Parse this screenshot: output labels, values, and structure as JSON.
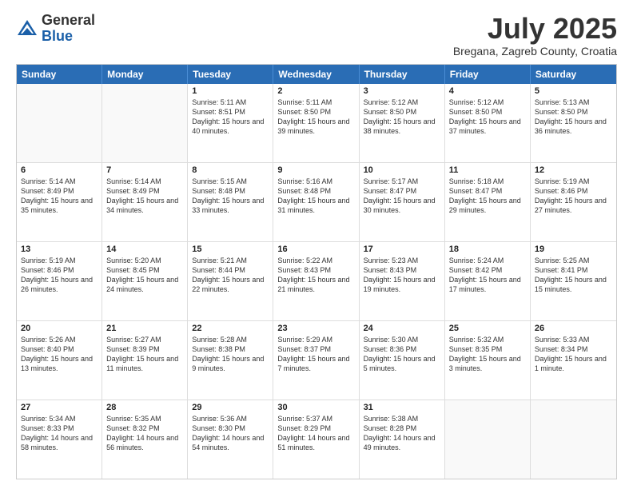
{
  "header": {
    "logo_general": "General",
    "logo_blue": "Blue",
    "month": "July 2025",
    "location": "Bregana, Zagreb County, Croatia"
  },
  "days_of_week": [
    "Sunday",
    "Monday",
    "Tuesday",
    "Wednesday",
    "Thursday",
    "Friday",
    "Saturday"
  ],
  "weeks": [
    [
      {
        "day": "",
        "empty": true
      },
      {
        "day": "",
        "empty": true
      },
      {
        "day": "1",
        "sunrise": "Sunrise: 5:11 AM",
        "sunset": "Sunset: 8:51 PM",
        "daylight": "Daylight: 15 hours and 40 minutes."
      },
      {
        "day": "2",
        "sunrise": "Sunrise: 5:11 AM",
        "sunset": "Sunset: 8:50 PM",
        "daylight": "Daylight: 15 hours and 39 minutes."
      },
      {
        "day": "3",
        "sunrise": "Sunrise: 5:12 AM",
        "sunset": "Sunset: 8:50 PM",
        "daylight": "Daylight: 15 hours and 38 minutes."
      },
      {
        "day": "4",
        "sunrise": "Sunrise: 5:12 AM",
        "sunset": "Sunset: 8:50 PM",
        "daylight": "Daylight: 15 hours and 37 minutes."
      },
      {
        "day": "5",
        "sunrise": "Sunrise: 5:13 AM",
        "sunset": "Sunset: 8:50 PM",
        "daylight": "Daylight: 15 hours and 36 minutes."
      }
    ],
    [
      {
        "day": "6",
        "sunrise": "Sunrise: 5:14 AM",
        "sunset": "Sunset: 8:49 PM",
        "daylight": "Daylight: 15 hours and 35 minutes."
      },
      {
        "day": "7",
        "sunrise": "Sunrise: 5:14 AM",
        "sunset": "Sunset: 8:49 PM",
        "daylight": "Daylight: 15 hours and 34 minutes."
      },
      {
        "day": "8",
        "sunrise": "Sunrise: 5:15 AM",
        "sunset": "Sunset: 8:48 PM",
        "daylight": "Daylight: 15 hours and 33 minutes."
      },
      {
        "day": "9",
        "sunrise": "Sunrise: 5:16 AM",
        "sunset": "Sunset: 8:48 PM",
        "daylight": "Daylight: 15 hours and 31 minutes."
      },
      {
        "day": "10",
        "sunrise": "Sunrise: 5:17 AM",
        "sunset": "Sunset: 8:47 PM",
        "daylight": "Daylight: 15 hours and 30 minutes."
      },
      {
        "day": "11",
        "sunrise": "Sunrise: 5:18 AM",
        "sunset": "Sunset: 8:47 PM",
        "daylight": "Daylight: 15 hours and 29 minutes."
      },
      {
        "day": "12",
        "sunrise": "Sunrise: 5:19 AM",
        "sunset": "Sunset: 8:46 PM",
        "daylight": "Daylight: 15 hours and 27 minutes."
      }
    ],
    [
      {
        "day": "13",
        "sunrise": "Sunrise: 5:19 AM",
        "sunset": "Sunset: 8:46 PM",
        "daylight": "Daylight: 15 hours and 26 minutes."
      },
      {
        "day": "14",
        "sunrise": "Sunrise: 5:20 AM",
        "sunset": "Sunset: 8:45 PM",
        "daylight": "Daylight: 15 hours and 24 minutes."
      },
      {
        "day": "15",
        "sunrise": "Sunrise: 5:21 AM",
        "sunset": "Sunset: 8:44 PM",
        "daylight": "Daylight: 15 hours and 22 minutes."
      },
      {
        "day": "16",
        "sunrise": "Sunrise: 5:22 AM",
        "sunset": "Sunset: 8:43 PM",
        "daylight": "Daylight: 15 hours and 21 minutes."
      },
      {
        "day": "17",
        "sunrise": "Sunrise: 5:23 AM",
        "sunset": "Sunset: 8:43 PM",
        "daylight": "Daylight: 15 hours and 19 minutes."
      },
      {
        "day": "18",
        "sunrise": "Sunrise: 5:24 AM",
        "sunset": "Sunset: 8:42 PM",
        "daylight": "Daylight: 15 hours and 17 minutes."
      },
      {
        "day": "19",
        "sunrise": "Sunrise: 5:25 AM",
        "sunset": "Sunset: 8:41 PM",
        "daylight": "Daylight: 15 hours and 15 minutes."
      }
    ],
    [
      {
        "day": "20",
        "sunrise": "Sunrise: 5:26 AM",
        "sunset": "Sunset: 8:40 PM",
        "daylight": "Daylight: 15 hours and 13 minutes."
      },
      {
        "day": "21",
        "sunrise": "Sunrise: 5:27 AM",
        "sunset": "Sunset: 8:39 PM",
        "daylight": "Daylight: 15 hours and 11 minutes."
      },
      {
        "day": "22",
        "sunrise": "Sunrise: 5:28 AM",
        "sunset": "Sunset: 8:38 PM",
        "daylight": "Daylight: 15 hours and 9 minutes."
      },
      {
        "day": "23",
        "sunrise": "Sunrise: 5:29 AM",
        "sunset": "Sunset: 8:37 PM",
        "daylight": "Daylight: 15 hours and 7 minutes."
      },
      {
        "day": "24",
        "sunrise": "Sunrise: 5:30 AM",
        "sunset": "Sunset: 8:36 PM",
        "daylight": "Daylight: 15 hours and 5 minutes."
      },
      {
        "day": "25",
        "sunrise": "Sunrise: 5:32 AM",
        "sunset": "Sunset: 8:35 PM",
        "daylight": "Daylight: 15 hours and 3 minutes."
      },
      {
        "day": "26",
        "sunrise": "Sunrise: 5:33 AM",
        "sunset": "Sunset: 8:34 PM",
        "daylight": "Daylight: 15 hours and 1 minute."
      }
    ],
    [
      {
        "day": "27",
        "sunrise": "Sunrise: 5:34 AM",
        "sunset": "Sunset: 8:33 PM",
        "daylight": "Daylight: 14 hours and 58 minutes."
      },
      {
        "day": "28",
        "sunrise": "Sunrise: 5:35 AM",
        "sunset": "Sunset: 8:32 PM",
        "daylight": "Daylight: 14 hours and 56 minutes."
      },
      {
        "day": "29",
        "sunrise": "Sunrise: 5:36 AM",
        "sunset": "Sunset: 8:30 PM",
        "daylight": "Daylight: 14 hours and 54 minutes."
      },
      {
        "day": "30",
        "sunrise": "Sunrise: 5:37 AM",
        "sunset": "Sunset: 8:29 PM",
        "daylight": "Daylight: 14 hours and 51 minutes."
      },
      {
        "day": "31",
        "sunrise": "Sunrise: 5:38 AM",
        "sunset": "Sunset: 8:28 PM",
        "daylight": "Daylight: 14 hours and 49 minutes."
      },
      {
        "day": "",
        "empty": true
      },
      {
        "day": "",
        "empty": true
      }
    ]
  ]
}
